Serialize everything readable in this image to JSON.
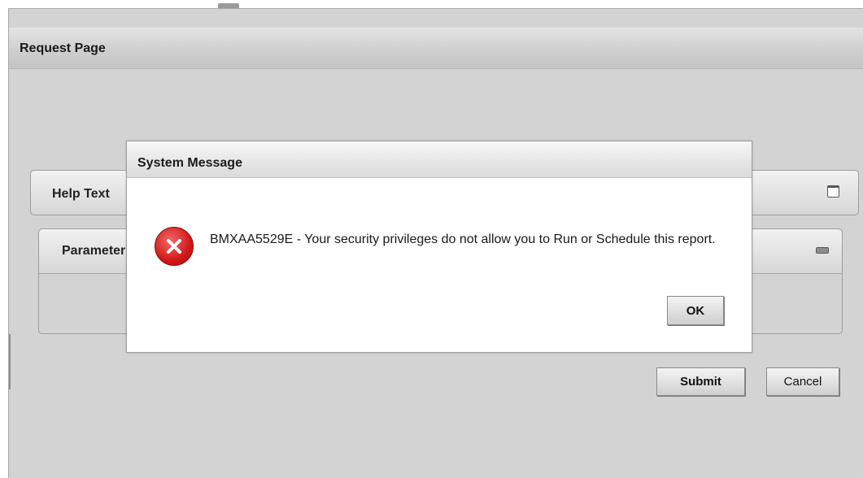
{
  "page": {
    "title": "Request Page",
    "help_section_label": "Help Text",
    "params_section_label": "Parameters",
    "submit_label": "Submit",
    "cancel_label": "Cancel"
  },
  "dialog": {
    "title": "System Message",
    "message": "BMXAA5529E - Your security privileges do not allow you to Run or Schedule this report.",
    "ok_label": "OK",
    "icon": "error-icon"
  }
}
